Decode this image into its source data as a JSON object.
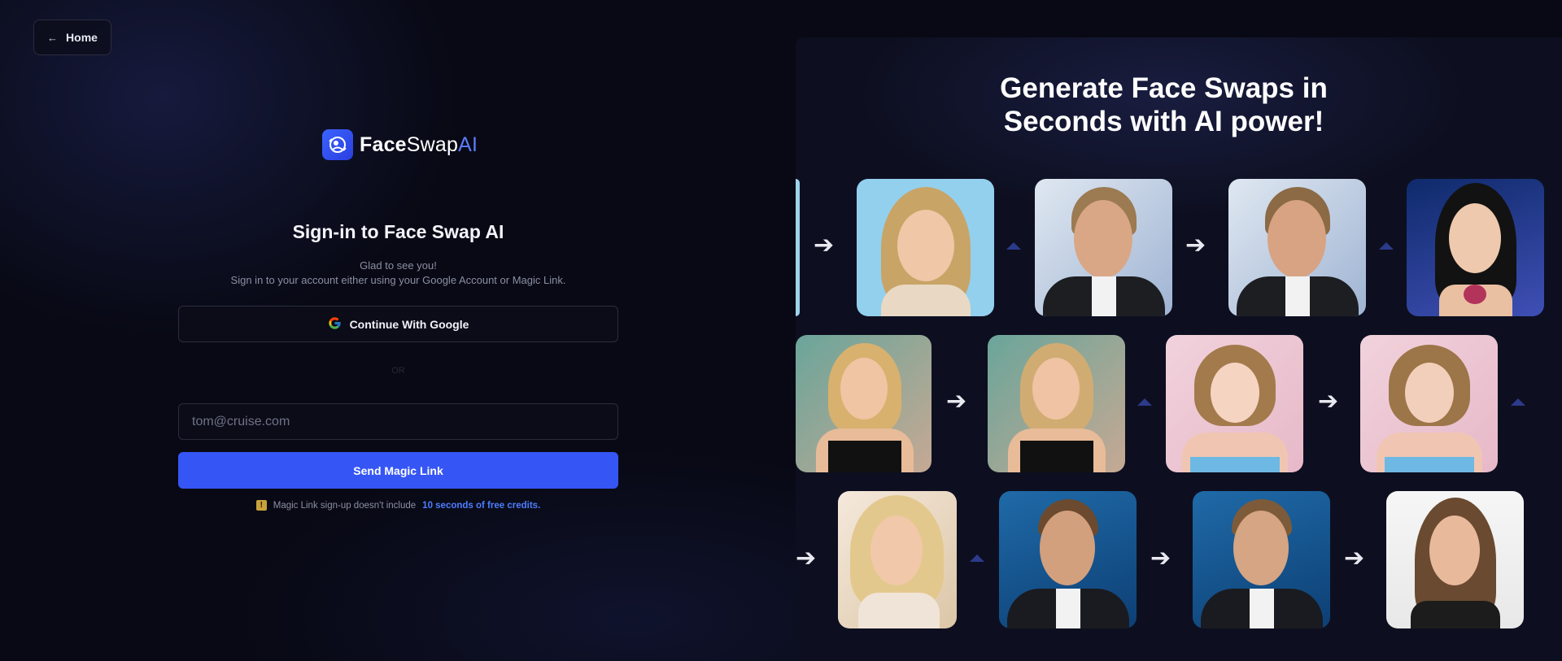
{
  "nav": {
    "home_label": "Home",
    "home_icon": "arrow-left-icon"
  },
  "brand": {
    "name_part1": "Face",
    "name_part2": "Swap",
    "name_part3": "AI",
    "accent": "#5b7cff"
  },
  "auth": {
    "title": "Sign-in to Face Swap AI",
    "subtitle_line1": "Glad to see you!",
    "subtitle_line2": "Sign in to your account either using your Google Account or Magic Link.",
    "google_button_label": "Continue With Google",
    "separator": "OR",
    "email_placeholder": "tom@cruise.com",
    "email_value": "",
    "magic_button_label": "Send Magic Link",
    "note_text": "Magic Link sign-up doesn't include",
    "note_highlight": "10 seconds of free credits."
  },
  "showcase": {
    "title_line1": "Generate Face Swaps in",
    "title_line2": "Seconds with AI power!"
  },
  "colors": {
    "background": "#080914",
    "primary_button": "#3556f5",
    "highlight_link": "#4d7dff",
    "panel": "#0d0f20"
  }
}
